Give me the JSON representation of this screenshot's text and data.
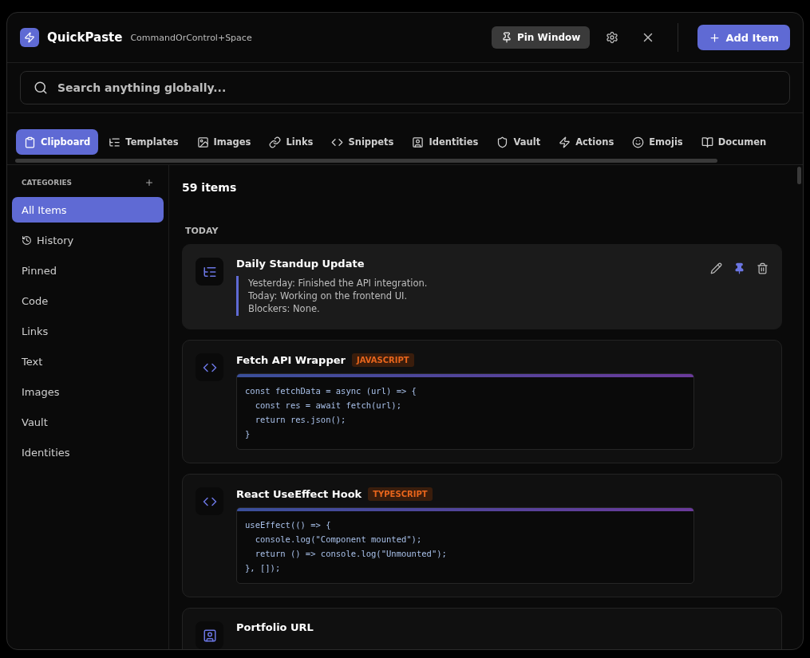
{
  "app": {
    "name": "QuickPaste",
    "shortcut": "CommandOrControl+Space"
  },
  "header_buttons": {
    "pin": "Pin Window",
    "add": "Add Item"
  },
  "search": {
    "placeholder": "Search anything globally..."
  },
  "tabs": [
    {
      "kind": "clipboard",
      "label": "Clipboard",
      "selected": true
    },
    {
      "kind": "templates",
      "label": "Templates",
      "selected": false
    },
    {
      "kind": "images",
      "label": "Images",
      "selected": false
    },
    {
      "kind": "links",
      "label": "Links",
      "selected": false
    },
    {
      "kind": "snippets",
      "label": "Snippets",
      "selected": false
    },
    {
      "kind": "identities",
      "label": "Identities",
      "selected": false
    },
    {
      "kind": "vault",
      "label": "Vault",
      "selected": false
    },
    {
      "kind": "actions",
      "label": "Actions",
      "selected": false
    },
    {
      "kind": "emojis",
      "label": "Emojis",
      "selected": false
    },
    {
      "kind": "documents",
      "label": "Documen",
      "selected": false
    }
  ],
  "sidebar": {
    "title": "CATEGORIES",
    "items": [
      {
        "label": "All Items",
        "selected": true,
        "kind": "plain"
      },
      {
        "label": "History",
        "selected": false,
        "kind": "history"
      },
      {
        "label": "Pinned",
        "selected": false,
        "kind": "plain"
      },
      {
        "label": "Code",
        "selected": false,
        "kind": "plain"
      },
      {
        "label": "Links",
        "selected": false,
        "kind": "plain"
      },
      {
        "label": "Text",
        "selected": false,
        "kind": "plain"
      },
      {
        "label": "Images",
        "selected": false,
        "kind": "plain"
      },
      {
        "label": "Vault",
        "selected": false,
        "kind": "plain"
      },
      {
        "label": "Identities",
        "selected": false,
        "kind": "plain"
      }
    ]
  },
  "content": {
    "count": "59 items",
    "group": "TODAY",
    "cards": [
      {
        "kind": "template",
        "title": "Daily Standup Update",
        "selected": true,
        "pinned": true,
        "lines": [
          "Yesterday: Finished the API integration.",
          "Today: Working on the frontend UI.",
          "Blockers: None."
        ]
      },
      {
        "kind": "code",
        "title": "Fetch API Wrapper",
        "selected": false,
        "language": "JAVASCRIPT",
        "lines": [
          "const fetchData = async (url) => {",
          "  const res = await fetch(url);",
          "  return res.json();",
          "}"
        ]
      },
      {
        "kind": "code",
        "title": "React UseEffect Hook",
        "selected": false,
        "language": "TYPESCRIPT",
        "lines": [
          "useEffect(() => {",
          "  console.log(\"Component mounted\");",
          "  return () => console.log(\"Unmounted\");",
          "}, []);"
        ]
      },
      {
        "kind": "identity",
        "title": "Portfolio URL",
        "selected": false
      }
    ]
  }
}
